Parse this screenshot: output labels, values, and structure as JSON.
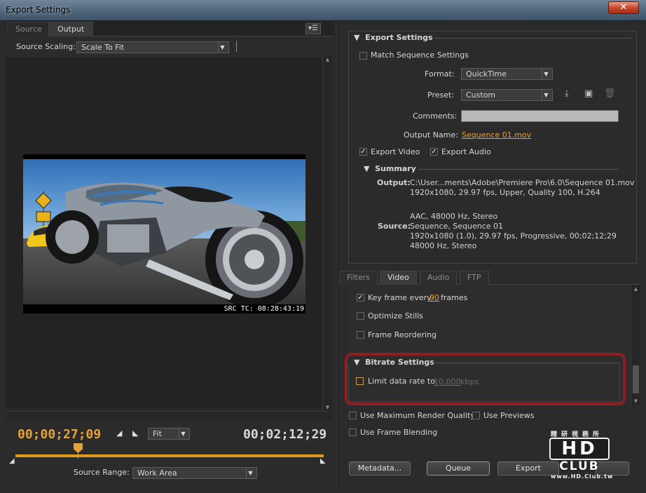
{
  "window": {
    "title": "Export Settings",
    "close_glyph": "✕"
  },
  "left": {
    "tabs": [
      "Source",
      "Output"
    ],
    "active_tab": "Output",
    "source_scaling_label": "Source Scaling:",
    "source_scaling_value": "Scale To Fit",
    "src_tc": "SRC TC: 08:28:43:19",
    "current_timecode": "00;00;27;09",
    "zoom_value": "Fit",
    "duration_timecode": "00;02;12;29",
    "source_range_label": "Source Range:",
    "source_range_value": "Work Area"
  },
  "export": {
    "section_title": "Export Settings",
    "match_sequence_label": "Match Sequence Settings",
    "match_sequence_checked": false,
    "format_label": "Format:",
    "format_value": "QuickTime",
    "preset_label": "Preset:",
    "preset_value": "Custom",
    "comments_label": "Comments:",
    "comments_value": "",
    "output_name_label": "Output Name:",
    "output_name_value": "Sequence 01.mov",
    "export_video_label": "Export Video",
    "export_video_checked": true,
    "export_audio_label": "Export Audio",
    "export_audio_checked": true
  },
  "summary": {
    "title": "Summary",
    "output_label": "Output:",
    "output_lines": [
      "C:\\User...ments\\Adobe\\Premiere Pro\\6.0\\Sequence 01.mov",
      "1920x1080, 29.97 fps, Upper, Quality 100, H.264",
      "",
      "AAC, 48000 Hz, Stereo"
    ],
    "source_label": "Source:",
    "source_lines": [
      "Sequence, Sequence 01",
      "1920x1080 (1.0), 29.97 fps, Progressive, 00;02;12;29",
      "48000 Hz, Stereo"
    ]
  },
  "tabs_right": [
    "Filters",
    "Video",
    "Audio",
    "FTP"
  ],
  "active_tab_right": "Video",
  "video": {
    "key_frame_label": "Key frame every",
    "key_frame_value": "90",
    "key_frame_unit": "frames",
    "key_frame_checked": true,
    "optimize_stills_label": "Optimize Stills",
    "optimize_stills_checked": false,
    "frame_reordering_label": "Frame Reordering",
    "frame_reordering_checked": false,
    "bitrate_title": "Bitrate Settings",
    "limit_data_rate_label": "Limit data rate to",
    "limit_data_rate_value": "10,000",
    "limit_data_rate_unit": "kbps",
    "limit_data_rate_checked": false
  },
  "bottom": {
    "max_render_quality_label": "Use Maximum Render Quality",
    "use_previews_label": "Use Previews",
    "frame_blending_label": "Use Frame Blending",
    "metadata_button": "Metadata...",
    "queue_button": "Queue",
    "export_button": "Export"
  },
  "watermark": {
    "top_text": "精研視務所",
    "logo_text": "HD",
    "club_text": "CLUB",
    "url_text": "www.HD.Club.tw"
  },
  "colors": {
    "accent_orange": "#e6a23a",
    "timeline_gold": "#e29b18",
    "highlight_red": "#8f1e22"
  }
}
